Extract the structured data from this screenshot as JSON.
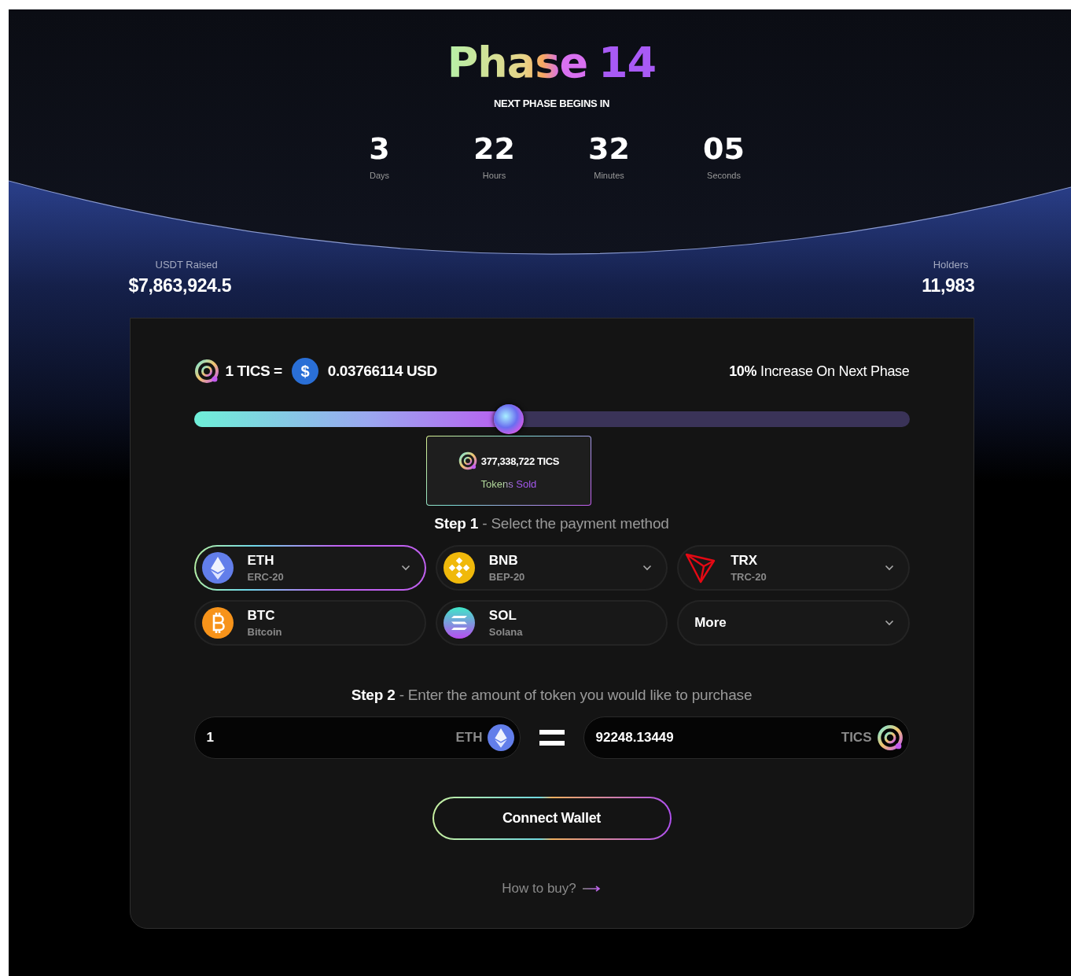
{
  "header": {
    "title": "Phase",
    "number": "14",
    "subtitle": "NEXT PHASE BEGINS IN"
  },
  "countdown": [
    {
      "value": "3",
      "label": "Days"
    },
    {
      "value": "22",
      "label": "Hours"
    },
    {
      "value": "32",
      "label": "Minutes"
    },
    {
      "value": "05",
      "label": "Seconds"
    }
  ],
  "stats": {
    "raised": {
      "label": "USDT Raised",
      "value": "$7,863,924.5"
    },
    "holders": {
      "label": "Holders",
      "value": "11,983"
    }
  },
  "price": {
    "token": "1 TICS =",
    "currency_symbol": "$",
    "value": "0.03766114 USD",
    "increase": "**10%** Increase On Next Phase"
  },
  "progress": {
    "level": 0.44,
    "sold": "377,338,722 TICS",
    "sold_label": "Tokens Sold"
  },
  "step1": {
    "step": "Step 1",
    "text": "- Select the payment method"
  },
  "methods": [
    {
      "kind": "eth",
      "symbol": "ETH",
      "network": "ERC-20",
      "selected": true,
      "dropdown": true
    },
    {
      "kind": "bnb",
      "symbol": "BNB",
      "network": "BEP-20",
      "selected": false,
      "dropdown": true
    },
    {
      "kind": "trx",
      "symbol": "TRX",
      "network": "TRC-20",
      "selected": false,
      "dropdown": true
    },
    {
      "kind": "btc",
      "symbol": "BTC",
      "network": "Bitcoin",
      "selected": false,
      "dropdown": false
    },
    {
      "kind": "sol",
      "symbol": "SOL",
      "network": "Solana",
      "selected": false,
      "dropdown": false
    },
    {
      "kind": "more",
      "symbol": "More",
      "selected": false,
      "dropdown": true
    }
  ],
  "step2": {
    "step": "Step 2",
    "text": "- Enter the amount of token you would like to purchase"
  },
  "pay": {
    "value": "1",
    "unit": "ETH"
  },
  "receive": {
    "value": "92248.13449",
    "unit": "TICS"
  },
  "connect_button": "Connect Wallet",
  "help_link": "How to buy?"
}
